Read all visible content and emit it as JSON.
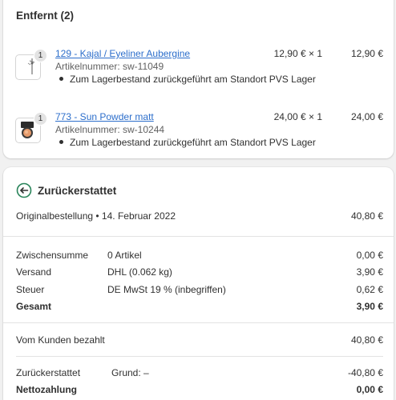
{
  "removed": {
    "title": "Entfernt (2)",
    "items": [
      {
        "qty_badge": "1",
        "name": "129 - Kajal / Eyeliner Aubergine",
        "sku": "Artikelnummer: sw-11049",
        "note": "Zum Lagerbestand zurückgeführt am Standort PVS Lager",
        "price": "12,90 € × 1",
        "total": "12,90 €",
        "thumb_icon": "eyeliner-pencil-icon"
      },
      {
        "qty_badge": "1",
        "name": "773 - Sun Powder matt",
        "sku": "Artikelnummer: sw-10244",
        "note": "Zum Lagerbestand zurückgeführt am Standort PVS Lager",
        "price": "24,00 € × 1",
        "total": "24,00 €",
        "thumb_icon": "powder-compact-icon"
      }
    ]
  },
  "refund": {
    "title": "Zurückerstattet",
    "status_icon": "refund-arrow-icon",
    "accent_color": "#29845a",
    "original_order_label": "Originalbestellung • 14. Februar 2022",
    "original_order_amount": "40,80 €",
    "summary_rows": [
      {
        "label": "Zwischensumme",
        "detail": "0 Artikel",
        "amount": "0,00 €"
      },
      {
        "label": "Versand",
        "detail": "DHL (0.062 kg)",
        "amount": "3,90 €"
      },
      {
        "label": "Steuer",
        "detail": "DE MwSt 19 % (inbegriffen)",
        "amount": "0,62 €"
      }
    ],
    "total_label": "Gesamt",
    "total_amount": "3,90 €",
    "paid_label": "Vom Kunden bezahlt",
    "paid_amount": "40,80 €",
    "refunded_label": "Zurückerstattet",
    "refunded_reason": "Grund: –",
    "refunded_amount": "-40,80 €",
    "net_label": "Nettozahlung",
    "net_amount": "0,00 €"
  }
}
